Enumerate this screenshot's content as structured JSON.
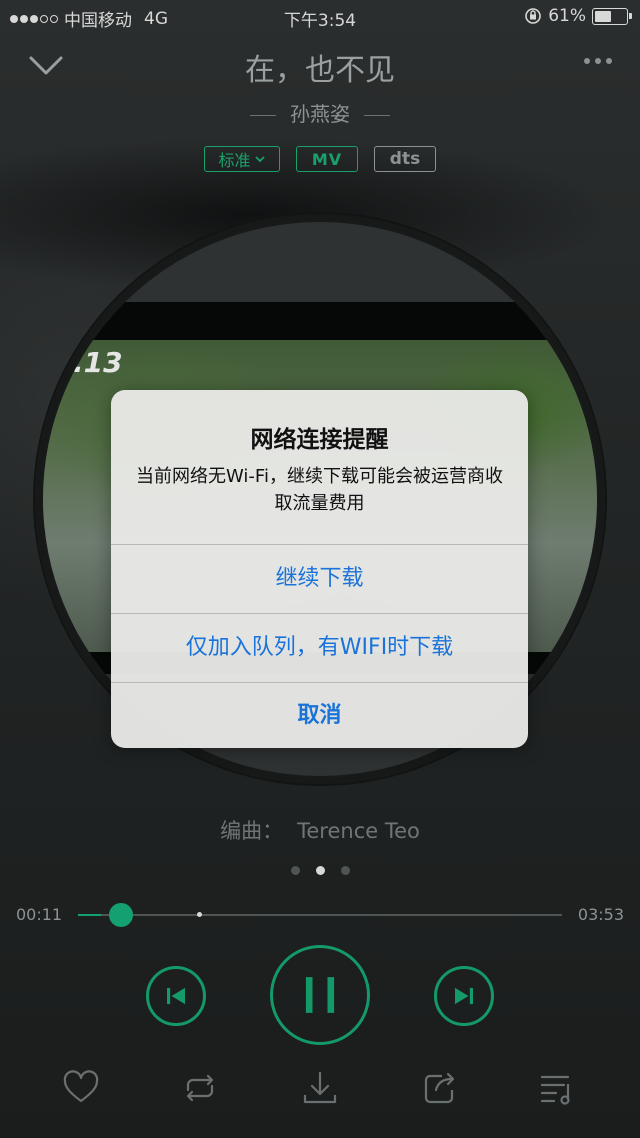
{
  "status_bar": {
    "carrier": "中国移动",
    "network": "4G",
    "time": "下午3:54",
    "battery": "61%",
    "battery_level": 0.61
  },
  "header": {
    "title": "在，也不见",
    "artist": "孙燕姿",
    "tags": {
      "quality": "标准",
      "mv": "MV",
      "dts": "dts"
    }
  },
  "album": {
    "cover_text": ".13"
  },
  "credit": {
    "label": "编曲：",
    "name": "Terence Teo"
  },
  "page_indicator": {
    "count": 3,
    "active": 1
  },
  "progress": {
    "current": "00:11",
    "total": "03:53",
    "played_fraction": 0.047,
    "buffered_fraction": 0.25
  },
  "dialog": {
    "title": "网络连接提醒",
    "message": "当前网络无Wi-Fi，继续下载可能会被运营商收取流量费用",
    "btn_continue": "继续下载",
    "btn_queue": "仅加入队列，有WIFI时下载",
    "btn_cancel": "取消"
  },
  "colors": {
    "accent": "#14a070",
    "link": "#1a73d9"
  },
  "icons": {
    "back": "chevron-down-icon",
    "more": "more-icon",
    "like": "heart-icon",
    "repeat": "repeat-icon",
    "download": "download-icon",
    "share": "share-icon",
    "playlist": "playlist-icon"
  }
}
